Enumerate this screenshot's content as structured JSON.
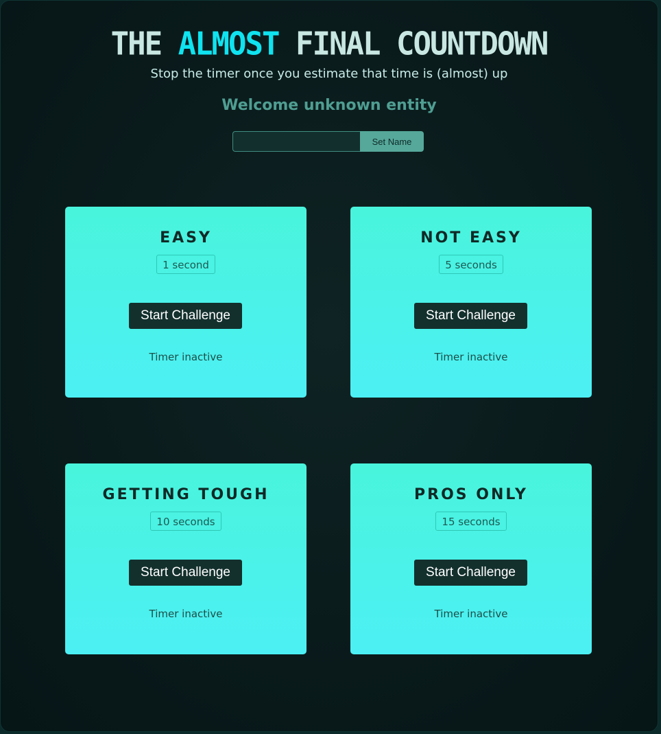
{
  "header": {
    "title_part1": "THE ",
    "title_accent": "ALMOST",
    "title_part2": " FINAL COUNTDOWN",
    "subtitle": "Stop the timer once you estimate that time is (almost) up",
    "welcome": "Welcome unknown entity"
  },
  "name_form": {
    "input_value": "",
    "input_placeholder": "",
    "button_label": "Set Name"
  },
  "challenges": [
    {
      "title": "EASY",
      "duration": "1 second",
      "button_label": "Start Challenge",
      "status": "Timer inactive"
    },
    {
      "title": "NOT EASY",
      "duration": "5 seconds",
      "button_label": "Start Challenge",
      "status": "Timer inactive"
    },
    {
      "title": "GETTING TOUGH",
      "duration": "10 seconds",
      "button_label": "Start Challenge",
      "status": "Timer inactive"
    },
    {
      "title": "PROS ONLY",
      "duration": "15 seconds",
      "button_label": "Start Challenge",
      "status": "Timer inactive"
    }
  ],
  "colors": {
    "accent": "#0fe3f0",
    "card_top": "#49f4dc",
    "card_bottom": "#4cf0f4",
    "button_dark": "#13302d",
    "welcome": "#4f9e92"
  }
}
